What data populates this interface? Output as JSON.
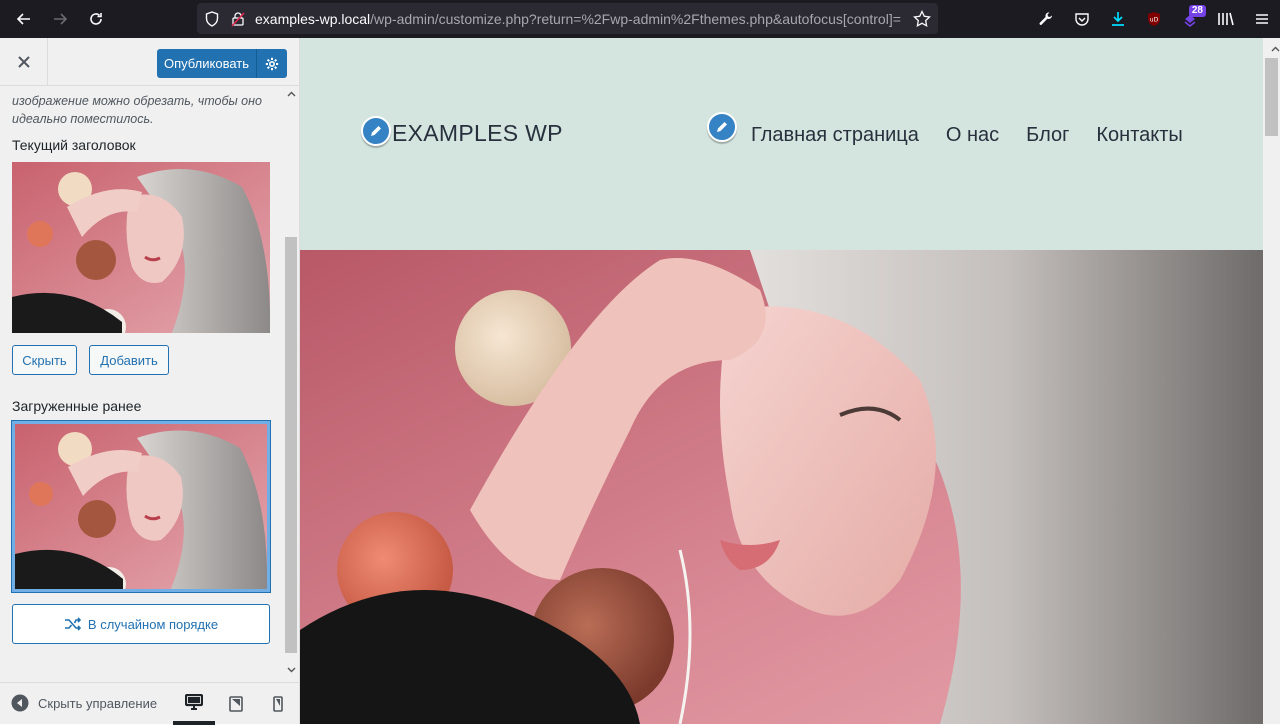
{
  "browser": {
    "url_host": "examples-wp.local",
    "url_path": "/wp-admin/customize.php?return=%2Fwp-admin%2Fthemes.php&autofocus[control]=",
    "extension_badge": "28"
  },
  "customizer": {
    "publish_label": "Опубликовать",
    "description": "изображение можно обрезать, чтобы оно идеально поместилось.",
    "current_header_title": "Текущий заголовок",
    "hide_label": "Скрыть",
    "add_label": "Добавить",
    "uploaded_title": "Загруженные ранее",
    "random_label": "В случайном порядке",
    "collapse_label": "Скрыть управление"
  },
  "site": {
    "title": "EXAMPLES WP",
    "menu": [
      "Главная страница",
      "О нас",
      "Блог",
      "Контакты"
    ],
    "header_bg": "#d4e5df"
  },
  "colors": {
    "accent": "#2271b1",
    "pencil": "#3582c4"
  }
}
